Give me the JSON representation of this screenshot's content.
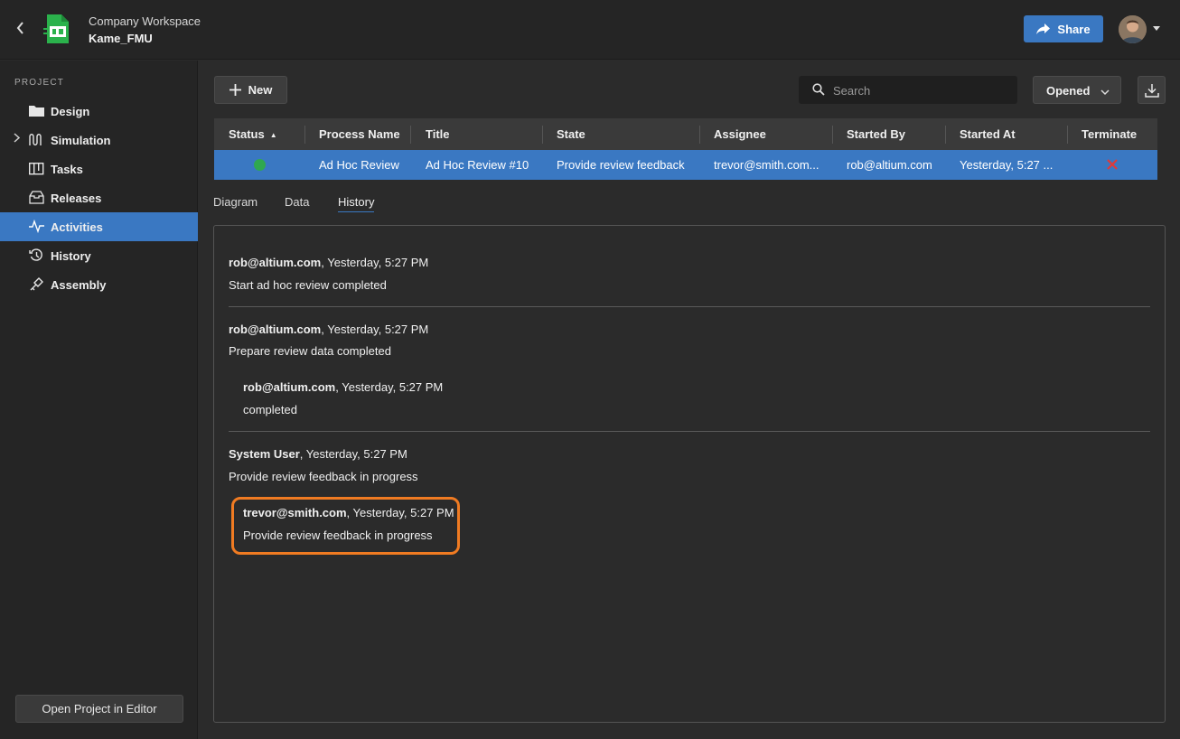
{
  "header": {
    "workspace": "Company Workspace",
    "project": "Kame_FMU",
    "share_label": "Share"
  },
  "sidebar": {
    "heading": "PROJECT",
    "items": [
      {
        "label": "Design",
        "icon": "folder-icon"
      },
      {
        "label": "Simulation",
        "icon": "simulation-icon"
      },
      {
        "label": "Tasks",
        "icon": "tasks-icon"
      },
      {
        "label": "Releases",
        "icon": "releases-icon"
      },
      {
        "label": "Activities",
        "icon": "activities-icon",
        "active": true
      },
      {
        "label": "History",
        "icon": "history-icon"
      },
      {
        "label": "Assembly",
        "icon": "assembly-icon"
      }
    ],
    "open_editor_label": "Open Project in Editor"
  },
  "toolbar": {
    "new_label": "New",
    "search_placeholder": "Search",
    "filter_label": "Opened"
  },
  "table": {
    "columns": [
      "Status",
      "Process Name",
      "Title",
      "State",
      "Assignee",
      "Started By",
      "Started At",
      "Terminate"
    ],
    "rows": [
      {
        "status": "running",
        "process_name": "Ad Hoc Review",
        "title": "Ad Hoc Review #10",
        "state": "Provide review feedback",
        "assignee": "trevor@smith.com...",
        "started_by": "rob@altium.com",
        "started_at": "Yesterday, 5:27 ..."
      }
    ]
  },
  "tabs": [
    "Diagram",
    "Data",
    "History"
  ],
  "history": [
    {
      "user": "rob@altium.com",
      "time": ", Yesterday, 5:27 PM",
      "text": "Start ad hoc review completed"
    },
    {
      "user": "rob@altium.com",
      "time": ", Yesterday, 5:27 PM",
      "text": "Prepare review data completed"
    },
    {
      "user": "rob@altium.com",
      "time": ", Yesterday, 5:27 PM",
      "text": "completed"
    },
    {
      "user": "System User",
      "time": ", Yesterday, 5:27 PM",
      "text": "Provide review feedback in progress"
    },
    {
      "user": "trevor@smith.com",
      "time": ", Yesterday, 5:27 PM",
      "text": "Provide review feedback in progress"
    }
  ],
  "colors": {
    "accent": "#3a78c2",
    "status_ok": "#2fa84f",
    "terminate": "#e03a3a",
    "highlight": "#f07b22"
  }
}
